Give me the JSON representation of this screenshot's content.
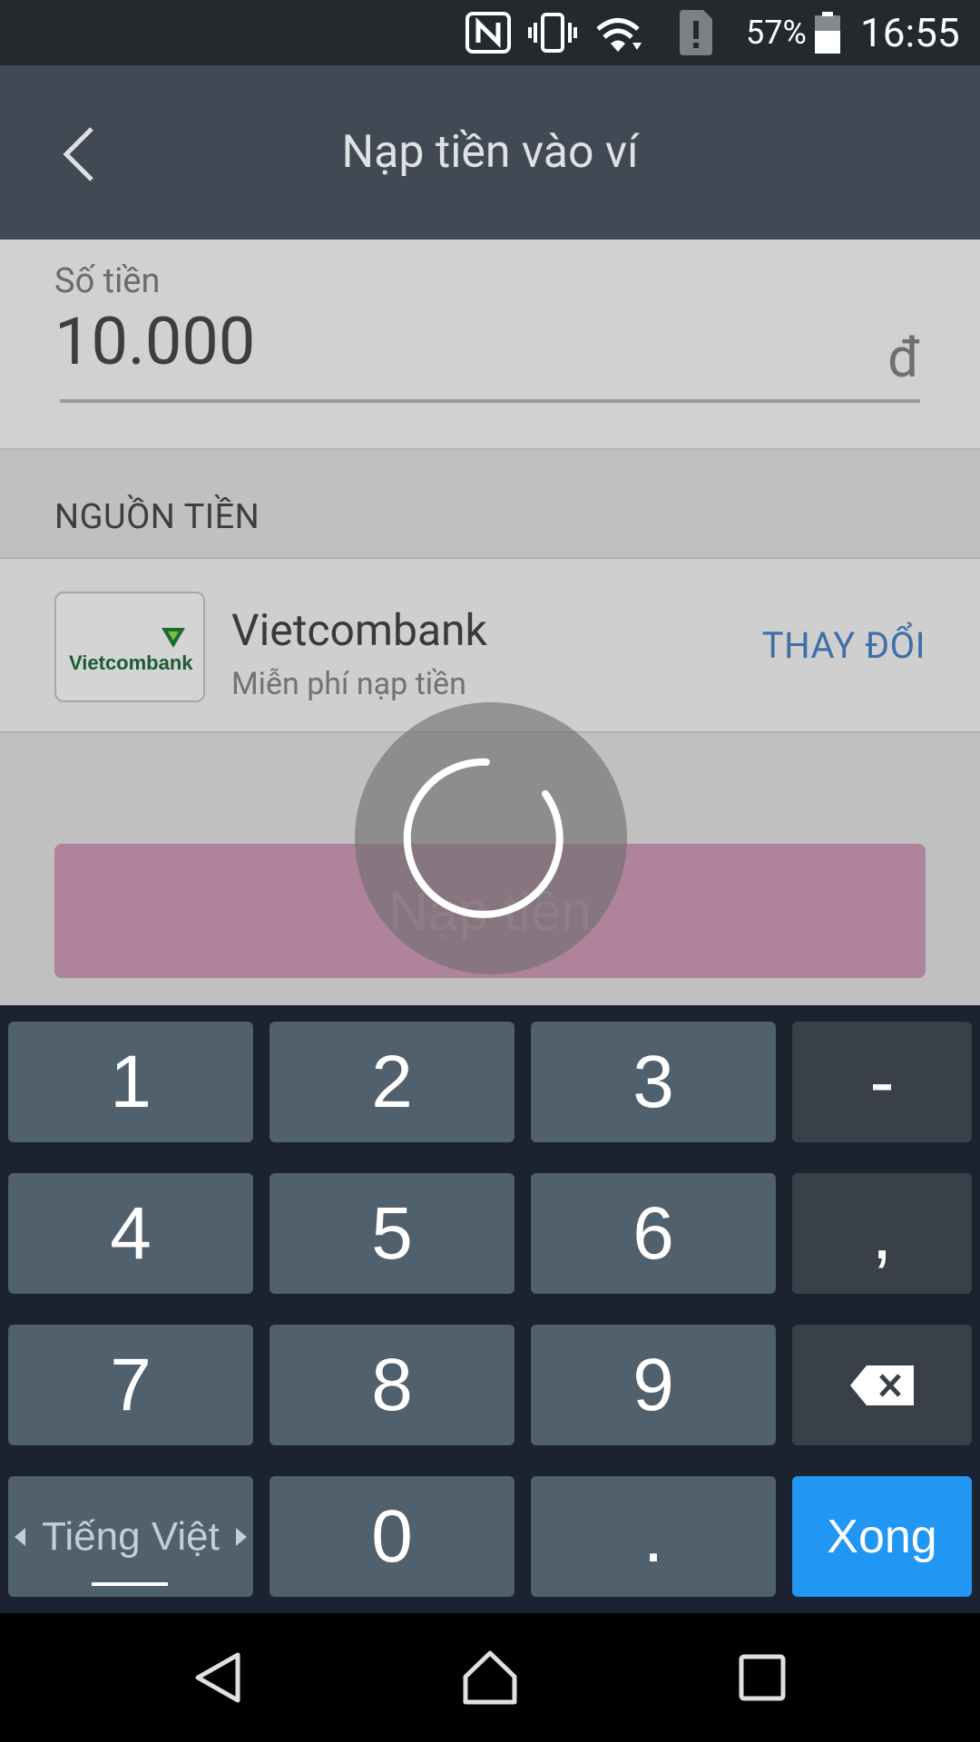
{
  "status_bar": {
    "battery_percent": "57%",
    "time": "16:55",
    "icons": [
      "nfc-icon",
      "vibrate-icon",
      "wifi-icon",
      "sim-alert-icon",
      "battery-icon"
    ]
  },
  "app_bar": {
    "title": "Nạp tiền vào ví",
    "back_icon": "chevron-left-icon"
  },
  "amount": {
    "label": "Số tiền",
    "value": "10.000",
    "currency": "đ"
  },
  "source": {
    "header": "NGUỒN TIỀN",
    "bank": {
      "logo_text": "Vietcombank",
      "name": "Vietcombank",
      "subtitle": "Miễn phí nạp tiền"
    },
    "change_label": "THAY ĐỔI"
  },
  "submit_label": "Nạp tiền",
  "loading": true,
  "keyboard": {
    "keys": {
      "k1": "1",
      "k2": "2",
      "k3": "3",
      "minus": "-",
      "k4": "4",
      "k5": "5",
      "k6": "6",
      "comma": ",",
      "k7": "7",
      "k8": "8",
      "k9": "9",
      "language": "Tiếng Việt",
      "k0": "0",
      "dot": ".",
      "done": "Xong"
    },
    "colors": {
      "key": "#51606d",
      "accent": "#2196f3"
    }
  },
  "nav_bar": {
    "icons": [
      "back-triangle-icon",
      "home-icon",
      "recents-icon"
    ]
  }
}
